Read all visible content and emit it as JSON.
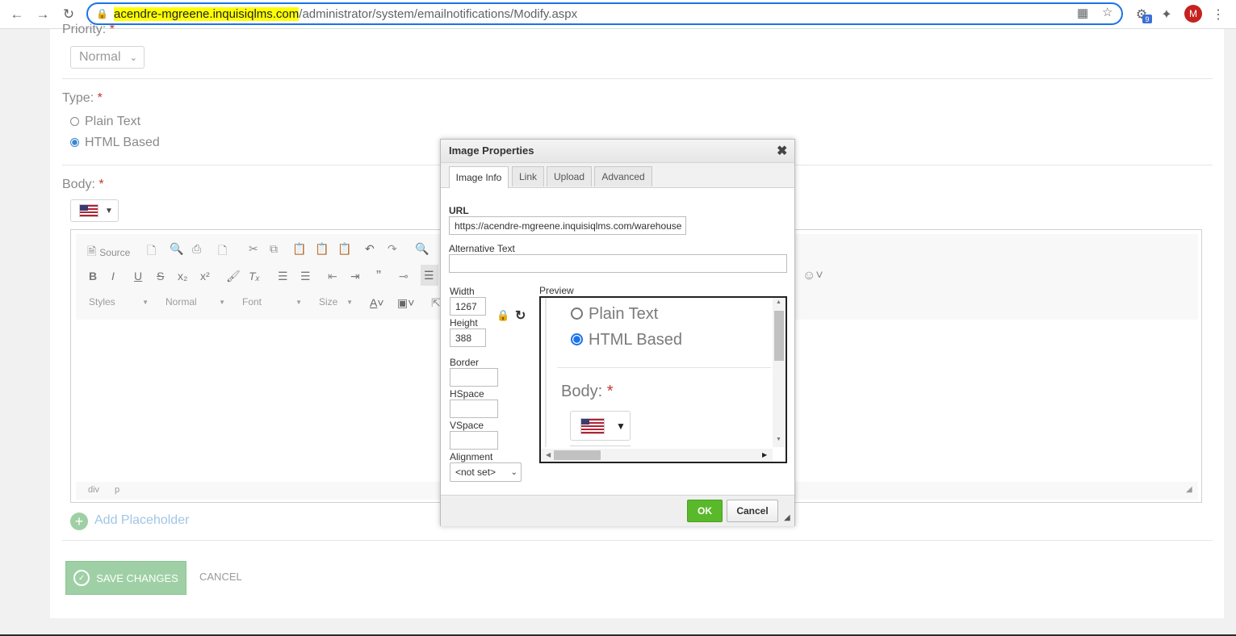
{
  "browser": {
    "url_highlighted": "acendre-mgreene.inquisiqlms.com",
    "url_rest": "/administrator/system/emailnotifications/Modify.aspx",
    "profile_initial": "M",
    "extension_badge": "9",
    "icons": [
      "back-icon",
      "forward-icon",
      "reload-icon",
      "lock-icon",
      "qr-icon",
      "star-icon",
      "extension-icon",
      "puzzle-icon",
      "menu-icon"
    ]
  },
  "form": {
    "priority_label": "Priority:",
    "priority_value": "Normal",
    "type_label": "Type:",
    "type_options": [
      "Plain Text",
      "HTML Based"
    ],
    "type_selected": "HTML Based",
    "body_label": "Body:",
    "required_mark": "*",
    "language_flag": "us-flag-icon"
  },
  "editor": {
    "source_label": "Source",
    "styles_label": "Styles",
    "format_label": "Normal",
    "font_label": "Font",
    "size_label": "Size",
    "path": [
      "div",
      "p"
    ]
  },
  "actions": {
    "add_placeholder": "Add Placeholder",
    "save_changes": "SAVE CHANGES",
    "cancel": "CANCEL"
  },
  "dialog": {
    "title": "Image Properties",
    "close": "✖",
    "tabs": [
      "Image Info",
      "Link",
      "Upload",
      "Advanced"
    ],
    "active_tab": "Image Info",
    "url_label": "URL",
    "url_value": "https://acendre-mgreene.inquisiqlms.com/warehouse",
    "alt_label": "Alternative Text",
    "alt_value": "",
    "width_label": "Width",
    "width_value": "1267",
    "height_label": "Height",
    "height_value": "388",
    "border_label": "Border",
    "hspace_label": "HSpace",
    "vspace_label": "VSpace",
    "alignment_label": "Alignment",
    "alignment_value": "<not set>",
    "preview_label": "Preview",
    "preview": {
      "options": [
        "Plain Text",
        "HTML Based"
      ],
      "body_label": "Body:",
      "required_mark": "*"
    },
    "ok": "OK",
    "cancel": "Cancel"
  },
  "colors": {
    "accent": "#1a73e8",
    "ok_button": "#5ab92b",
    "save_button": "#9fd0a5",
    "required": "#c0392b",
    "url_highlight": "#ffff00"
  }
}
